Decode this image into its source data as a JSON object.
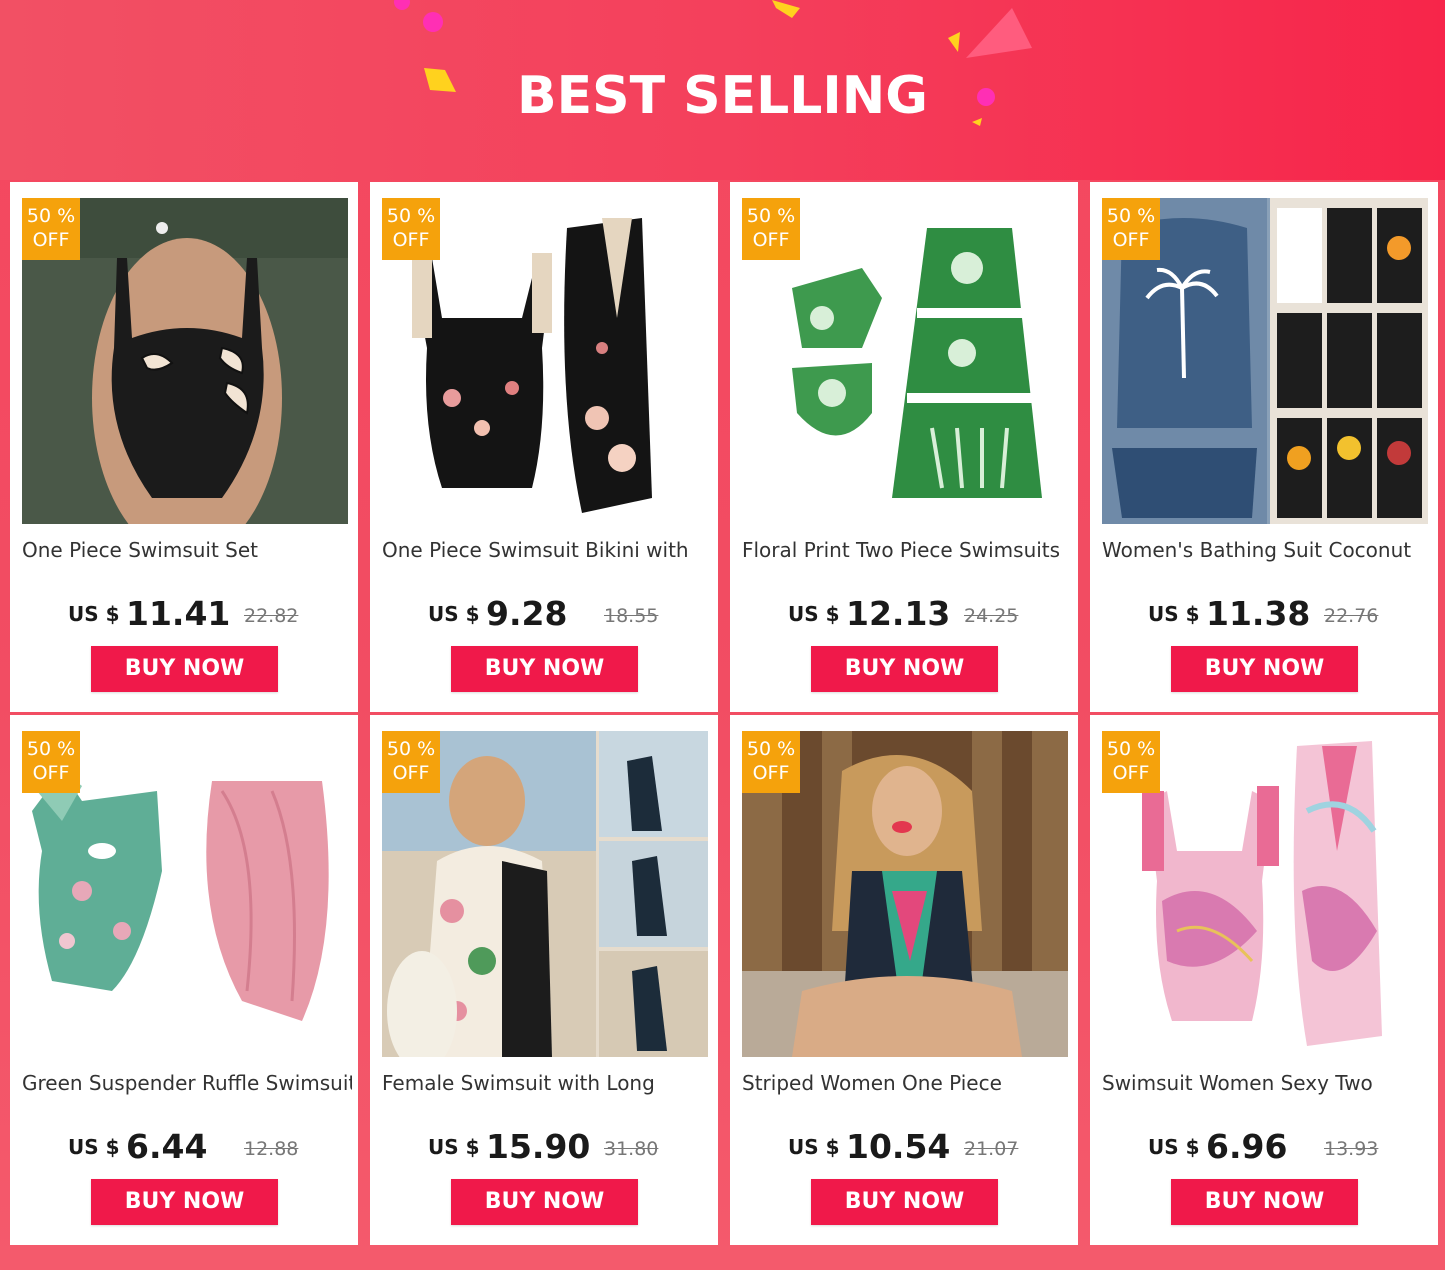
{
  "banner": {
    "title": "BEST SELLING",
    "background_color": "#f4405c"
  },
  "badge": {
    "line1": "50 %",
    "line2": "OFF",
    "color": "#f5a20c"
  },
  "buy_button_color": "#f0194a",
  "products": [
    {
      "title": "One Piece Swimsuit Set",
      "currency": "US $",
      "price": "11.41",
      "original_price": "22.82",
      "button": "BUY NOW",
      "image": "black-swimsuit-photo"
    },
    {
      "title": "One Piece Swimsuit Bikini with",
      "currency": "US $",
      "price": "9.28",
      "original_price": "18.55",
      "button": "BUY NOW",
      "image": "black-floral-swimsuit-and-skirt"
    },
    {
      "title": "Floral Print Two Piece Swimsuits",
      "currency": "US $",
      "price": "12.13",
      "original_price": "24.25",
      "button": "BUY NOW",
      "image": "green-floral-swimsuit-and-skirt"
    },
    {
      "title": "Women's Bathing Suit Coconut",
      "currency": "US $",
      "price": "11.38",
      "original_price": "22.76",
      "button": "BUY NOW",
      "image": "palm-tree-tankini-collage"
    },
    {
      "title": "Green Suspender Ruffle Swimsuit",
      "currency": "US $",
      "price": "6.44",
      "original_price": "12.88",
      "button": "BUY NOW",
      "image": "green-ruffle-swimsuit-and-pink-sarong"
    },
    {
      "title": "Female Swimsuit with Long",
      "currency": "US $",
      "price": "15.90",
      "original_price": "31.80",
      "button": "BUY NOW",
      "image": "long-sleeve-surf-swimsuit-photos"
    },
    {
      "title": "Striped Women One Piece",
      "currency": "US $",
      "price": "10.54",
      "original_price": "21.07",
      "button": "BUY NOW",
      "image": "tribal-print-swimsuit-photo"
    },
    {
      "title": "Swimsuit Women Sexy Two",
      "currency": "US $",
      "price": "6.96",
      "original_price": "13.93",
      "button": "BUY NOW",
      "image": "pink-marble-swimsuit-and-skirt"
    }
  ]
}
